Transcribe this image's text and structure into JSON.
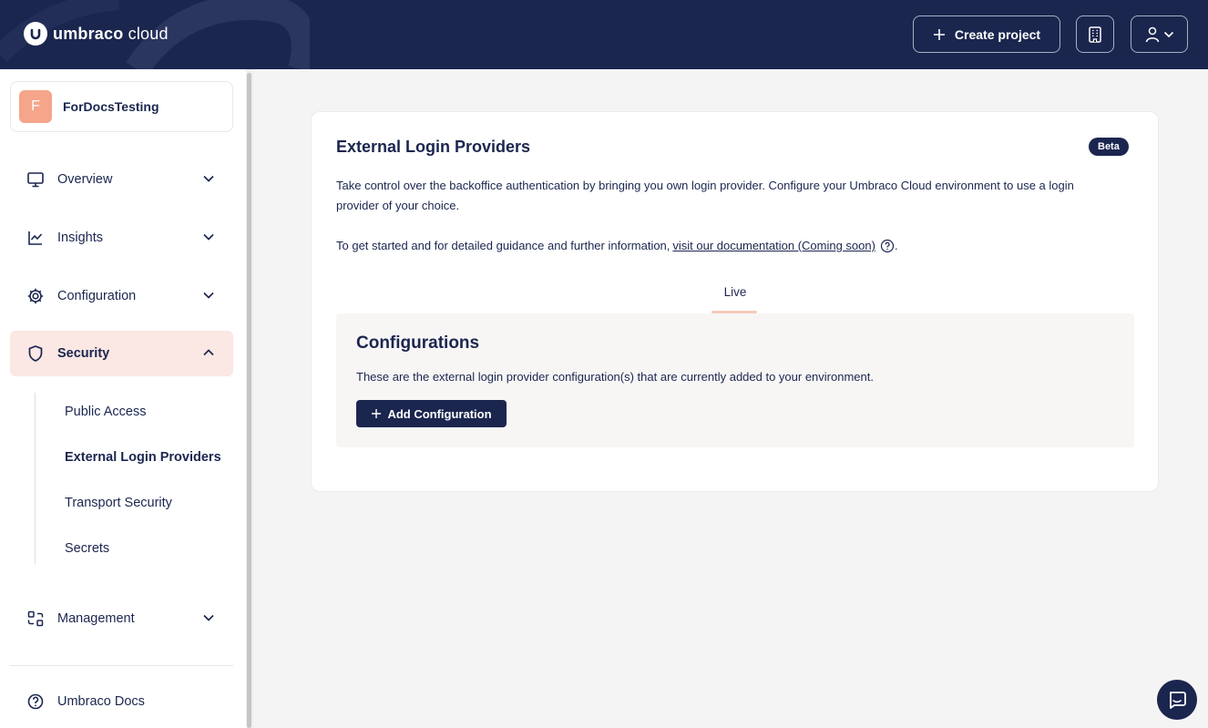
{
  "header": {
    "logo_bold": "umbraco",
    "logo_light": "cloud",
    "create_project_label": "Create project",
    "org_icon": "building-icon",
    "user_icon": "user-icon"
  },
  "project": {
    "avatar_letter": "F",
    "name": "ForDocsTesting"
  },
  "nav": {
    "overview": "Overview",
    "insights": "Insights",
    "configuration": "Configuration",
    "security": "Security",
    "management": "Management",
    "docs": "Umbraco Docs"
  },
  "security_sub": {
    "public_access": "Public Access",
    "external_login": "External Login Providers",
    "transport": "Transport Security",
    "secrets": "Secrets"
  },
  "main": {
    "title": "External Login Providers",
    "badge": "Beta",
    "description": "Take control over the backoffice authentication by bringing you own login provider. Configure your Umbraco Cloud environment to use a login provider of your choice.",
    "guide_prefix": "To get started and for detailed guidance and further information,",
    "guide_link": "visit our documentation (Coming soon)",
    "guide_suffix": ".",
    "tab_live": "Live",
    "configs_title": "Configurations",
    "configs_desc": "These are the external login provider configuration(s) that are currently added to your environment.",
    "add_button": "Add Configuration"
  },
  "colors": {
    "brand_navy": "#1b264f",
    "active_bg": "#fbe7e3",
    "avatar": "#f5a58a"
  }
}
